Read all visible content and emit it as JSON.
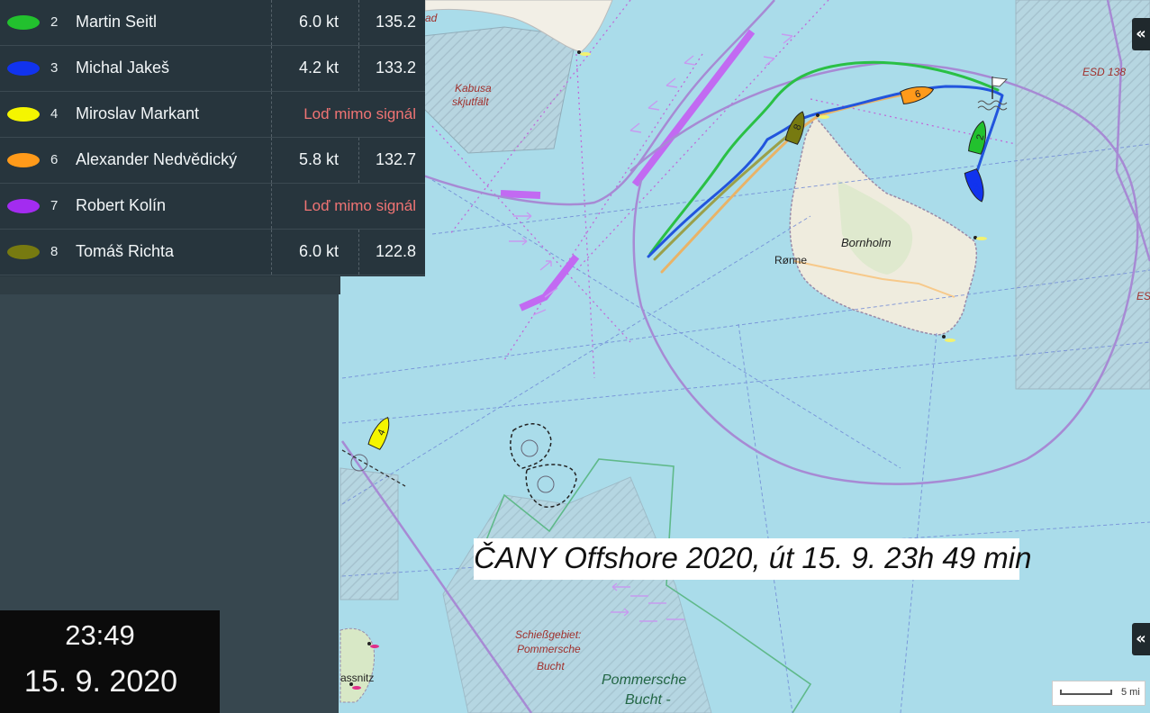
{
  "leaderboard": {
    "rows": [
      {
        "num": "2",
        "name": "Martin Seitl",
        "speed": "6.0 kt",
        "distance": "135.2",
        "signal": "",
        "color": "#22c12e"
      },
      {
        "num": "3",
        "name": "Michal Jakeš",
        "speed": "4.2 kt",
        "distance": "133.2",
        "signal": "",
        "color": "#1133ee"
      },
      {
        "num": "4",
        "name": "Miroslav Markant",
        "speed": "",
        "distance": "",
        "signal": "Loď mimo signál",
        "color": "#f5f500"
      },
      {
        "num": "6",
        "name": "Alexander Nedvědický",
        "speed": "5.8 kt",
        "distance": "132.7",
        "signal": "",
        "color": "#ff9a1a"
      },
      {
        "num": "7",
        "name": "Robert Kolín",
        "speed": "",
        "distance": "",
        "signal": "Loď mimo signál",
        "color": "#a32cf0"
      },
      {
        "num": "8",
        "name": "Tomáš Richta",
        "speed": "6.0 kt",
        "distance": "122.8",
        "signal": "",
        "color": "#777a10"
      }
    ]
  },
  "clock": {
    "time": "23:49",
    "date": "15. 9. 2020"
  },
  "caption": "ČANY Offshore 2020, út 15. 9. 23h 49 min",
  "map": {
    "labels": {
      "kabusa_1": "Kabusa",
      "kabusa_2": "skjutfält",
      "bornholm": "Bornholm",
      "ronne": "Rønne",
      "esd_138": "ESD 138",
      "esd_cut": "ES",
      "schiess_1": "Schießgebiet:",
      "schiess_2": "Pommersche",
      "schiess_3": "Bucht",
      "pommersche_1": "Pommersche",
      "pommersche_2": "Bucht -",
      "top_cut": "ad",
      "sassnitz_cut": "assnitz"
    },
    "boat_markers": [
      {
        "num": "2",
        "color": "#22c12e"
      },
      {
        "num": "3",
        "color": "#1133ee"
      },
      {
        "num": "4",
        "color": "#f5f500"
      },
      {
        "num": "6",
        "color": "#ff9a1a"
      },
      {
        "num": "8",
        "color": "#777a10"
      }
    ],
    "scale_label": "5 mi"
  },
  "controls": {
    "collapse_symbol": "«"
  }
}
